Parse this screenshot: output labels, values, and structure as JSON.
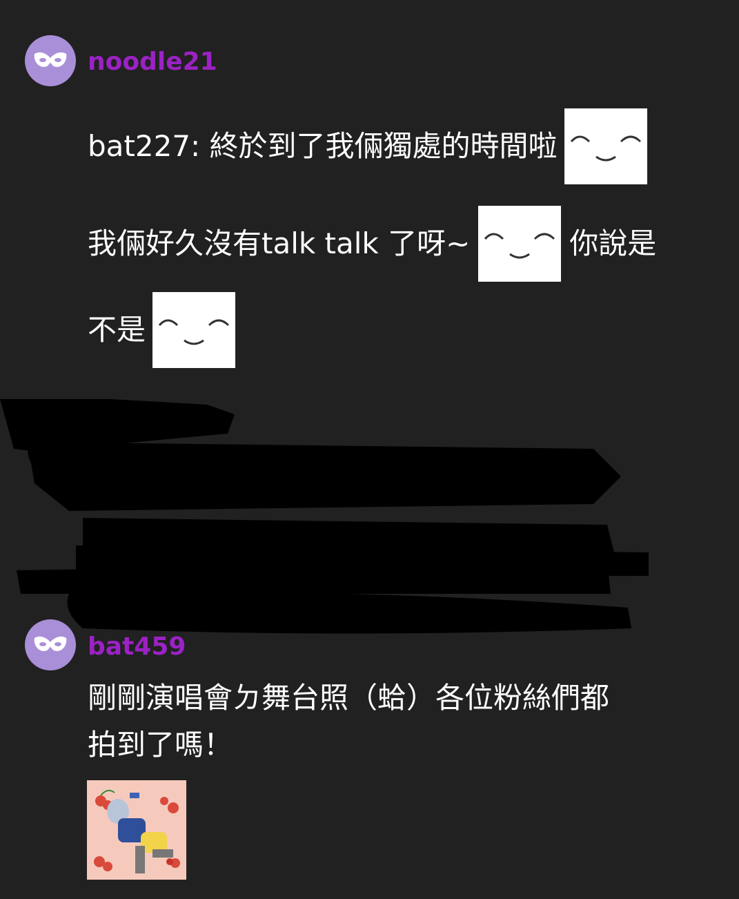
{
  "posts": [
    {
      "username": "noodle21",
      "avatar_icon": "mask-icon",
      "lines": [
        {
          "text": "bat227: 終於到了我倆獨處的時間啦",
          "emote_after": "smile-emote"
        },
        {
          "text": "我倆好久沒有talk talk 了呀~",
          "emote_after": "smile-emote",
          "trailing_text": "你說是"
        },
        {
          "text": "不是",
          "emote_after": "smile-emote"
        }
      ]
    },
    {
      "username": "bat459",
      "avatar_icon": "mask-icon",
      "lines": [
        {
          "text": "剛剛演唱會ㄉ舞台照（蛤）各位粉絲們都"
        },
        {
          "text": "拍到了嗎！"
        }
      ],
      "attachment_icon": "anime-photo-thumbnail"
    }
  ],
  "colors": {
    "background": "#212121",
    "username": "#9b22c4",
    "avatar": "#a98fd8",
    "text": "#ffffff",
    "redaction": "#000000"
  }
}
